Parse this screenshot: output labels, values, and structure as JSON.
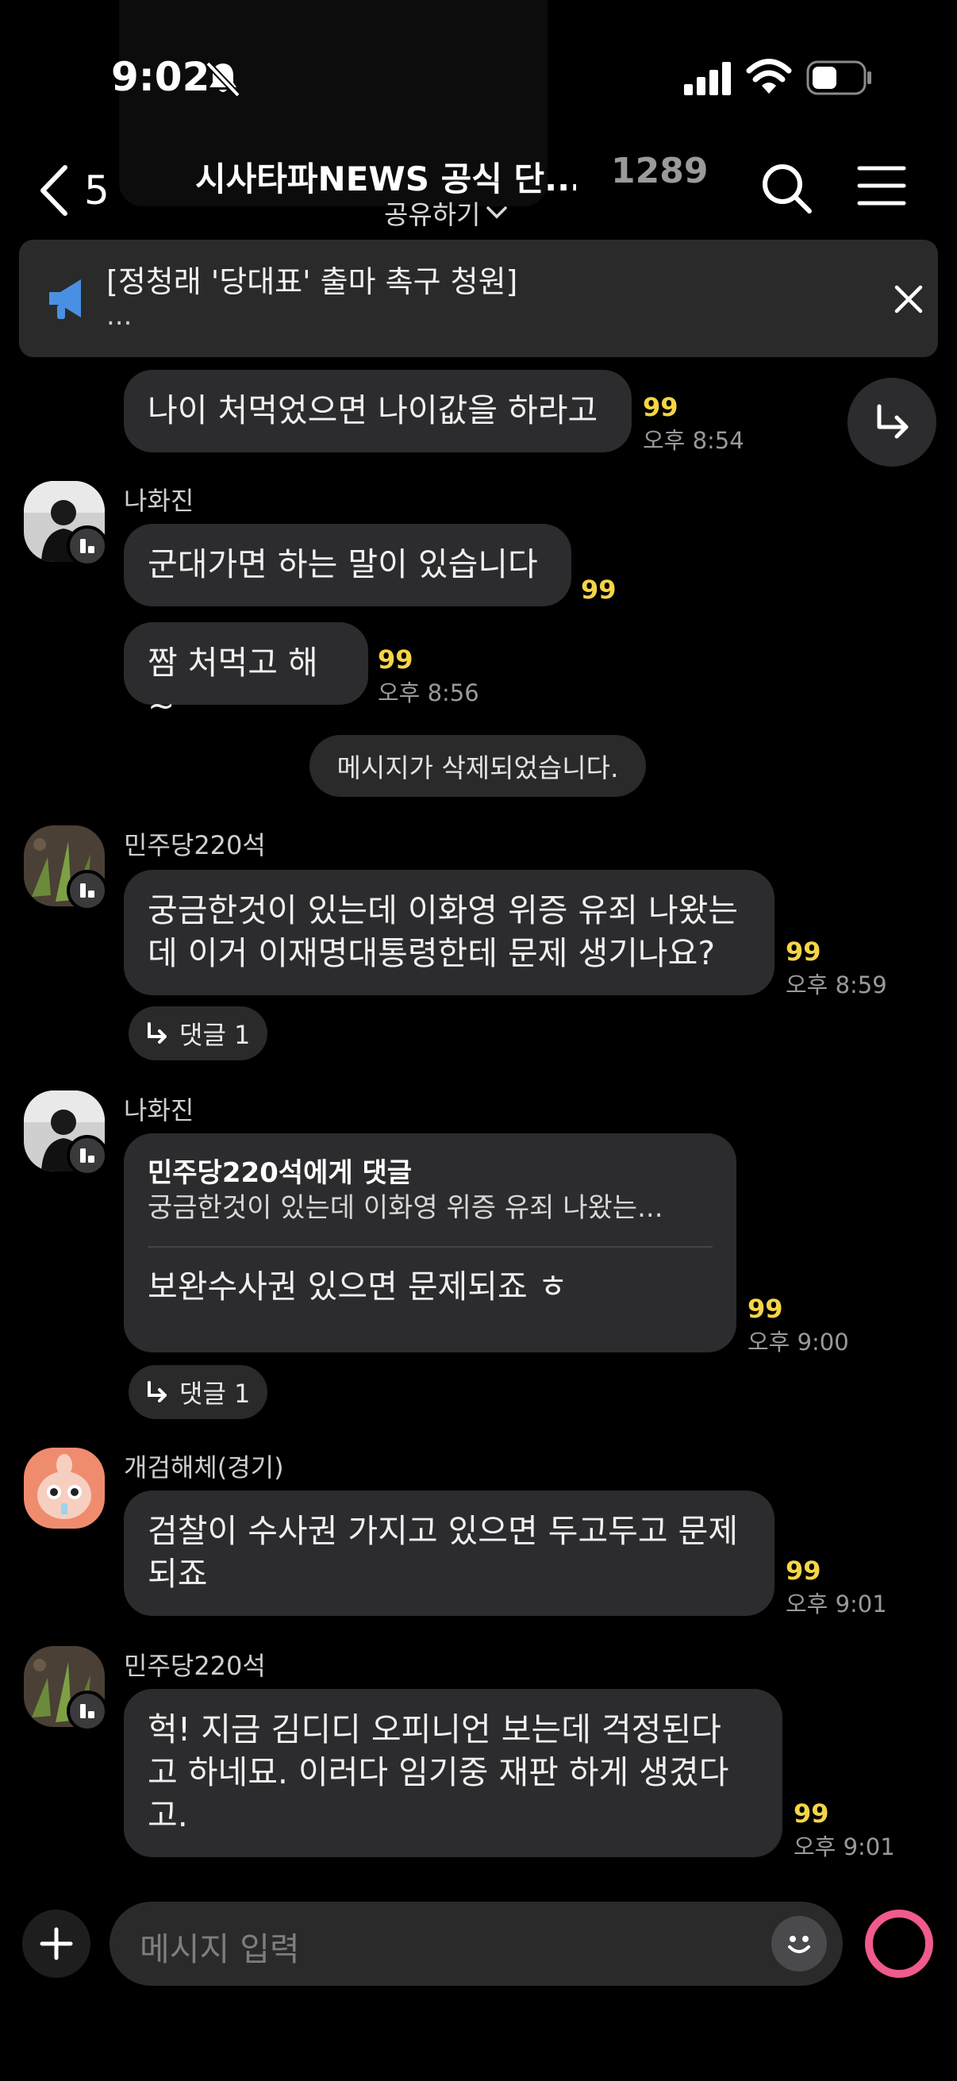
{
  "status_bar": {
    "time": "9:02"
  },
  "header": {
    "back_count": "5",
    "title": "시사타파NEWS 공식 단...",
    "member_count": "1289",
    "share_label": "공유하기"
  },
  "notice": {
    "title": "[정청래 '당대표' 출마 촉구 청원]",
    "more": "..."
  },
  "messages": [
    {
      "text": "나이 처먹었으면 나이값을 하라고",
      "unread": "99",
      "time": "오후 8:54"
    },
    {
      "sender": "나화진",
      "text": "군대가면 하는 말이 있습니다",
      "unread": "99"
    },
    {
      "text": "짬 처먹고 해~",
      "unread": "99",
      "time": "오후 8:56"
    },
    {
      "system": "메시지가 삭제되었습니다."
    },
    {
      "sender": "민주당220석",
      "text": "궁금한것이 있는데 이화영 위증 유죄 나왔는\n데 이거 이재명대통령한테 문제 생기나요?",
      "unread": "99",
      "time": "오후 8:59",
      "reply_chip": "댓글 1"
    },
    {
      "sender": "나화진",
      "reply_to": "민주당220석에게 댓글",
      "quote": "궁금한것이 있는데 이화영 위증 유죄 나왔는...",
      "text": "보완수사권 있으면 문제되죠 ㅎ",
      "unread": "99",
      "time": "오후 9:00",
      "reply_chip": "댓글 1"
    },
    {
      "sender": "개검해체(경기)",
      "text": "검찰이 수사권 가지고 있으면 두고두고 문제\n되죠",
      "unread": "99",
      "time": "오후 9:01"
    },
    {
      "sender": "민주당220석",
      "text": "헉!   지금 김디디 오피니언 보는데  걱정된다\n고 하네묘.   이러다 임기중 재판 하게 생겼다\n고.",
      "unread": "99",
      "time": "오후 9:01"
    }
  ],
  "input": {
    "placeholder": "메시지 입력"
  },
  "colors": {
    "unread": "#f5d547",
    "bubble": "#2c2c2e",
    "send": "#f05a8c",
    "notice_icon": "#4a90e2"
  }
}
